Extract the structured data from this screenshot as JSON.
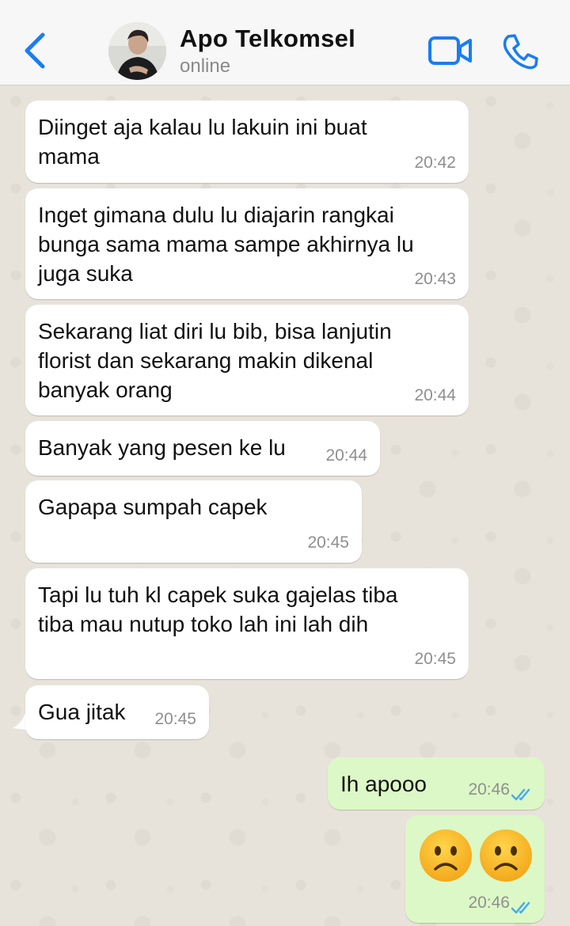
{
  "header": {
    "contact_name": "Apo Telkomsel",
    "status": "online"
  },
  "colors": {
    "accent": "#1a7df0",
    "incoming_bubble": "#ffffff",
    "outgoing_bubble": "#dcf8c6",
    "read_ticks": "#4aa9f0"
  },
  "messages": [
    {
      "text": "Diinget aja kalau lu lakuin ini buat\nmama",
      "time": "20:42",
      "direction": "incoming"
    },
    {
      "text": "Inget gimana dulu lu diajarin rangkai\nbunga sama mama sampe akhirnya lu\njuga suka",
      "time": "20:43",
      "direction": "incoming"
    },
    {
      "text": "Sekarang liat diri lu bib, bisa lanjutin\nflorist dan sekarang makin dikenal\nbanyak orang",
      "time": "20:44",
      "direction": "incoming"
    },
    {
      "text": "Banyak yang pesen ke lu",
      "time": "20:44",
      "direction": "incoming"
    },
    {
      "text": "Gapapa sumpah capek",
      "time": "20:45",
      "direction": "incoming"
    },
    {
      "text": "Tapi lu tuh kl capek suka gajelas tiba\ntiba mau nutup toko lah ini lah dih",
      "time": "20:45",
      "direction": "incoming"
    },
    {
      "text": "Gua jitak",
      "time": "20:45",
      "direction": "incoming"
    },
    {
      "text": "Ih apooo",
      "time": "20:46",
      "direction": "outgoing",
      "status": "read"
    },
    {
      "emoji": [
        "frowning-face",
        "frowning-face"
      ],
      "time": "20:46",
      "direction": "outgoing",
      "status": "read"
    }
  ]
}
